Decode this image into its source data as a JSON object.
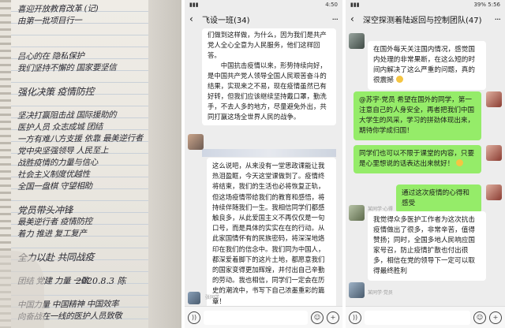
{
  "notebook": {
    "lines": [
      "喜迎开放教育改革 (记)",
      "由第一批项目行一",
      "",
      "",
      "吕心的在 隐私保护",
      "我们坚持不懈的 国家要坚信",
      "",
      "强化决策 疫情防控",
      "",
      "坚决打赢阻击战 国际援助的",
      "医护人员 众志成城 团结",
      "一方有难八方支援 依靠 最美逆行者",
      "党中央坚强领导 人民至上",
      "战胜疫情的力量与信心",
      "社会主义制度优越性",
      "全国一盘棋 守望相助",
      "",
      "党员带头冲锋",
      "最美逆行者 疫情防控",
      "着力 推进 复工复产",
      "",
      "全力以赴 共同战疫",
      "",
      "团结 党建 力量 一致",
      "",
      "中国力量 中国精神 中国效率",
      "向奋战在一线的医护人员致敬"
    ],
    "signature": "2020.8.3  陈"
  },
  "chat1": {
    "status_time": "4:50",
    "title": "飞设一班(34)",
    "back": "‹",
    "more": "···",
    "paragraph1": "们做到这样做，为什么，因为我们是共产党人全心全意为人民服务，他们这样回答。",
    "paragraph2": "中国抗击疫情以来，形势持续向好，是中国共产党人领导全国人民艰苦奋斗的结果，实现来之不易，现在疫情虽然已有好转，但我们应该继续坚持戴口罩，勤洗手，不去人多的地方，尽量避免外出，共同打赢这场全世界人民的战争。",
    "message2": "这么说吧，从来没有一堂思政课能让我热泪盈眶，今天这堂课做到了。疫情终将结束，我们的生活也必将恢复正轨，但这场疫情带给我们的教育和感悟，将持续伴随我们一生。我相信同学们都感触良多，从此爱国主义不再仅仅是一句口号，而是具体的实实在在的行动。从此家国情怀有的民族密码，将深深地烙印在我们的信念中。我们同为中国人，都深爱着脚下的这片土地，都愿意我们的国家变得更加辉煌，并付出自己辛勤的劳动。我也相信，同学们一定会在历史的潮流中，书写下自己浓墨重彩的篇章！",
    "nick_bottom": "张同学"
  },
  "chat2": {
    "status_time": "5:56",
    "status_battery": "39%",
    "title": "深空探测着陆返回与控制团队(47)",
    "back": "‹",
    "more": "···",
    "msg1": "在国外每天关注国内情况，感觉国内处理的非常果断，在这么短的时间内解决了这么严重的问题，真的很震撼",
    "msg2": "@苏宇·党员 希望在国外的同学，第一注意自己的人身安全，再者把我们中国大学生的风采，学习的拼劲体现出来，期待你学成归国！",
    "msg3": "同学们也可以不限于课堂的内容，只要是心里想说的话表达出来就好！",
    "msg4": "通过这次疫情的心得和感受",
    "nick5": "某同学·心得",
    "msg5": "我觉得众多医护工作者为这次抗击疫情做出了很多，非常辛苦，值得赞扬；同时，全国多地人民响应国家号召，防止疫情扩散也付出很多，相信在党的领导下一定可以取得最终胜利",
    "nick6": "某同学·党员"
  },
  "colors": {
    "bubble_out": "#95ec69",
    "bubble_in": "#ffffff",
    "chat_bg": "#ededed"
  },
  "icons": [
    "voice-icon",
    "emoji-icon",
    "plus-icon",
    "back-icon",
    "more-icon"
  ]
}
